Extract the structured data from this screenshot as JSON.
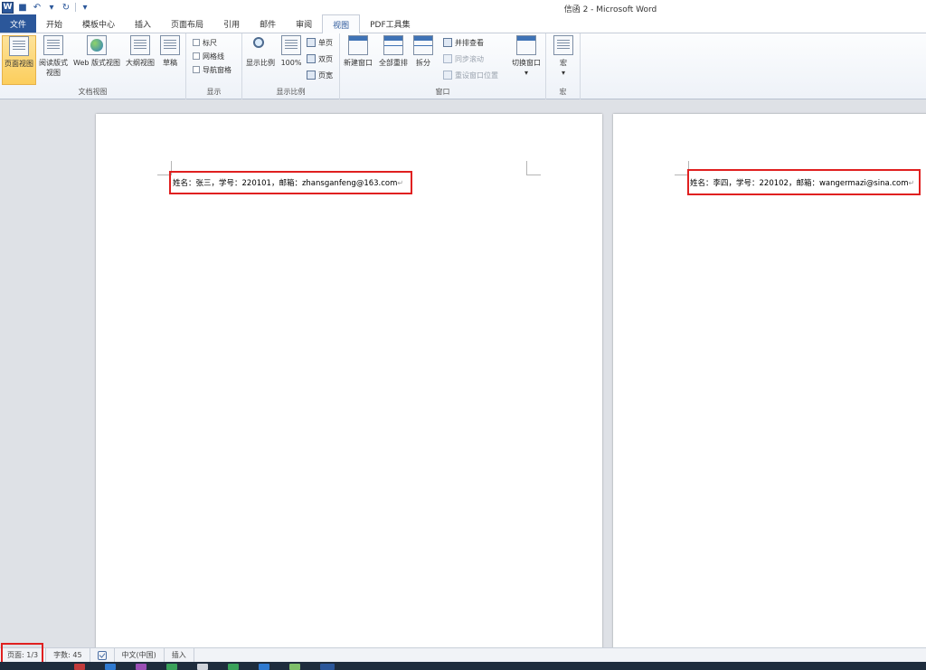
{
  "titlebar": {
    "title": "信函 2  -  Microsoft Word"
  },
  "tabs": [
    {
      "label": "文件",
      "active": false,
      "is_file": true
    },
    {
      "label": "开始",
      "active": false
    },
    {
      "label": "模板中心",
      "active": false
    },
    {
      "label": "插入",
      "active": false
    },
    {
      "label": "页面布局",
      "active": false
    },
    {
      "label": "引用",
      "active": false
    },
    {
      "label": "邮件",
      "active": false
    },
    {
      "label": "审阅",
      "active": false
    },
    {
      "label": "视图",
      "active": true
    },
    {
      "label": "PDF工具集",
      "active": false
    }
  ],
  "ribbon": {
    "doc_views": {
      "group_label": "文档视图",
      "page_view": "页面视图",
      "reading_view_1": "阅读版式",
      "reading_view_2": "视图",
      "web_view": "Web 版式视图",
      "outline_view": "大纲视图",
      "draft_view": "草稿"
    },
    "show": {
      "group_label": "显示",
      "ruler": "标尺",
      "gridlines": "网格线",
      "nav_pane": "导航窗格"
    },
    "zoom": {
      "group_label": "显示比例",
      "zoom": "显示比例",
      "hundred": "100%",
      "one_page": "单页",
      "two_pages": "双页",
      "page_width": "页宽"
    },
    "window": {
      "group_label": "窗口",
      "new_window": "新建窗口",
      "arrange_all": "全部重排",
      "split": "拆分",
      "side_by_side": "并排查看",
      "sync_scroll": "同步滚动",
      "reset_position": "重设窗口位置",
      "switch_windows": "切换窗口"
    },
    "macros": {
      "group_label": "宏",
      "macros": "宏"
    }
  },
  "document": {
    "page1_line": "姓名：张三，学号：220101，邮箱：zhansganfeng@163.com",
    "page2_line": "姓名：李四，学号：220102，邮箱：wangermazi@sina.com",
    "para_mark": "↵"
  },
  "statusbar": {
    "page": "页面: 1/3",
    "words": "字数: 45",
    "language": "中文(中国)",
    "mode": "插入"
  },
  "colors": {
    "accent": "#2b579a",
    "highlight_box": "#e02020",
    "selected_button": "#fcce5c"
  }
}
